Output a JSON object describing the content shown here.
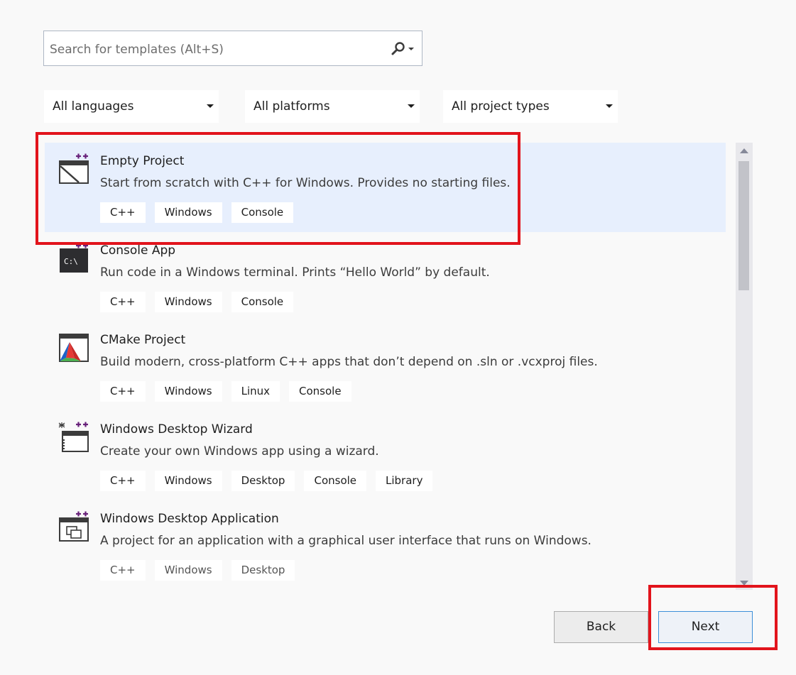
{
  "search": {
    "placeholder": "Search for templates (Alt+S)",
    "icon": "search-icon"
  },
  "filters": [
    {
      "label": "All languages"
    },
    {
      "label": "All platforms"
    },
    {
      "label": "All project types"
    }
  ],
  "templates": [
    {
      "title": "Empty Project",
      "description": "Start from scratch with C++ for Windows. Provides no starting files.",
      "tags": [
        "C++",
        "Windows",
        "Console"
      ],
      "icon": "empty-project-icon",
      "selected": true
    },
    {
      "title": "Console App",
      "description": "Run code in a Windows terminal. Prints “Hello World” by default.",
      "tags": [
        "C++",
        "Windows",
        "Console"
      ],
      "icon": "console-app-icon"
    },
    {
      "title": "CMake Project",
      "description": "Build modern, cross-platform C++ apps that don’t depend on .sln or .vcxproj files.",
      "tags": [
        "C++",
        "Windows",
        "Linux",
        "Console"
      ],
      "icon": "cmake-icon"
    },
    {
      "title": "Windows Desktop Wizard",
      "description": "Create your own Windows app using a wizard.",
      "tags": [
        "C++",
        "Windows",
        "Desktop",
        "Console",
        "Library"
      ],
      "icon": "desktop-wizard-icon"
    },
    {
      "title": "Windows Desktop Application",
      "description": "A project for an application with a graphical user interface that runs on Windows.",
      "tags": [
        "C++",
        "Windows",
        "Desktop"
      ],
      "icon": "desktop-application-icon"
    }
  ],
  "actions": {
    "back_label": "Back",
    "next_label": "Next"
  },
  "colors": {
    "selected_background": "#e7effd",
    "highlight_box": "#e2141c",
    "primary_button_border": "#3c8fd8",
    "cpp_plus": "#68217a"
  }
}
